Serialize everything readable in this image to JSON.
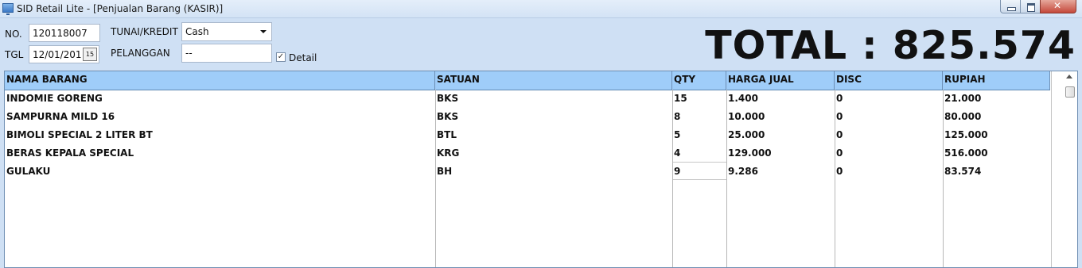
{
  "window": {
    "title": "SID Retail Lite - [Penjualan Barang (KASIR)]"
  },
  "form": {
    "no_label": "NO.",
    "no_value": "120118007",
    "tgl_label": "TGL",
    "tgl_value": "12/01/201",
    "date_button": "15",
    "payment_label": "TUNAI/KREDIT",
    "payment_value": "Cash",
    "customer_label": "PELANGGAN",
    "customer_value": "--",
    "detail_label": "Detail",
    "detail_checked": true,
    "detail_check_mark": "✓"
  },
  "total_text": "TOTAL : 825.574",
  "table": {
    "headers": [
      "NAMA BARANG",
      "SATUAN",
      "QTY",
      "HARGA JUAL",
      "DISC",
      "RUPIAH"
    ],
    "rows": [
      [
        "INDOMIE GORENG",
        "BKS",
        "15",
        "1.400",
        "0",
        "21.000"
      ],
      [
        "SAMPURNA MILD 16",
        "BKS",
        "8",
        "10.000",
        "0",
        "80.000"
      ],
      [
        "BIMOLI SPECIAL 2 LITER BT",
        "BTL",
        "5",
        "25.000",
        "0",
        "125.000"
      ],
      [
        "BERAS KEPALA SPECIAL",
        "KRG",
        "4",
        "129.000",
        "0",
        "516.000"
      ],
      [
        "GULAKU",
        "BH",
        "9",
        "9.286",
        "0",
        "83.574"
      ]
    ]
  },
  "colors": {
    "header_bg": "#9fcdf9",
    "window_bg": "#cfe0f4"
  }
}
